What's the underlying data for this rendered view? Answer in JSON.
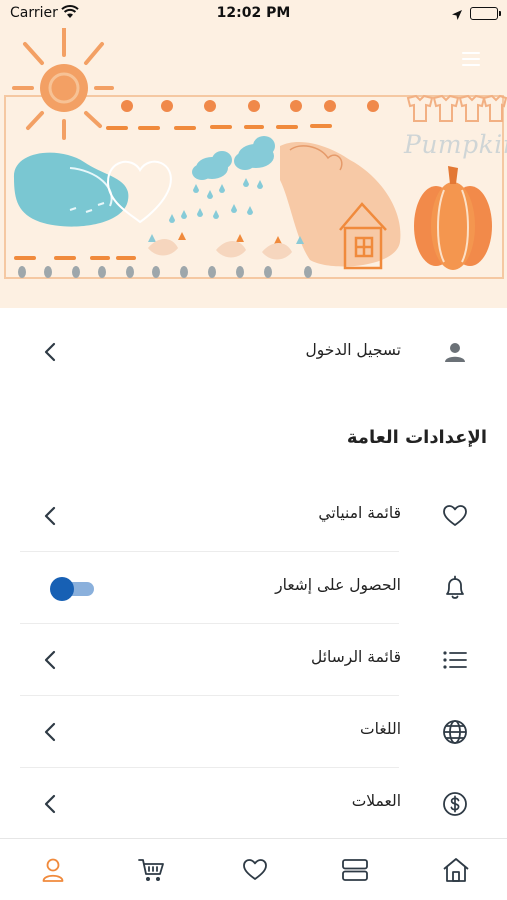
{
  "status_bar": {
    "carrier": "Carrier",
    "time": "12:02 PM"
  },
  "banner": {
    "brand_text": "Pumpkin",
    "menu_icon": "hamburger-menu-icon"
  },
  "login": {
    "label": "تسجيل الدخول",
    "icon": "user-icon"
  },
  "general_settings": {
    "title": "الإعدادات العامة",
    "items": [
      {
        "label": "قائمة امنياتي",
        "icon": "heart-icon",
        "control": "chevron"
      },
      {
        "label": "الحصول على إشعار",
        "icon": "bell-icon",
        "control": "toggle",
        "toggle_on": true
      },
      {
        "label": "قائمة الرسائل",
        "icon": "list-icon",
        "control": "chevron"
      },
      {
        "label": "اللغات",
        "icon": "globe-icon",
        "control": "chevron"
      },
      {
        "label": "العملات",
        "icon": "dollar-circle-icon",
        "control": "chevron"
      }
    ]
  },
  "tab_bar": {
    "items": [
      {
        "icon": "profile-icon",
        "active": true
      },
      {
        "icon": "cart-icon",
        "active": false
      },
      {
        "icon": "heart-icon",
        "active": false
      },
      {
        "icon": "categories-icon",
        "active": false
      },
      {
        "icon": "home-icon",
        "active": false
      }
    ]
  },
  "colors": {
    "accent": "#f08a3c",
    "banner_bg": "#fdf0e2",
    "toggle_knob": "#1760b4",
    "toggle_track": "#8ab0dc",
    "icon_gray": "#2e3a45"
  }
}
